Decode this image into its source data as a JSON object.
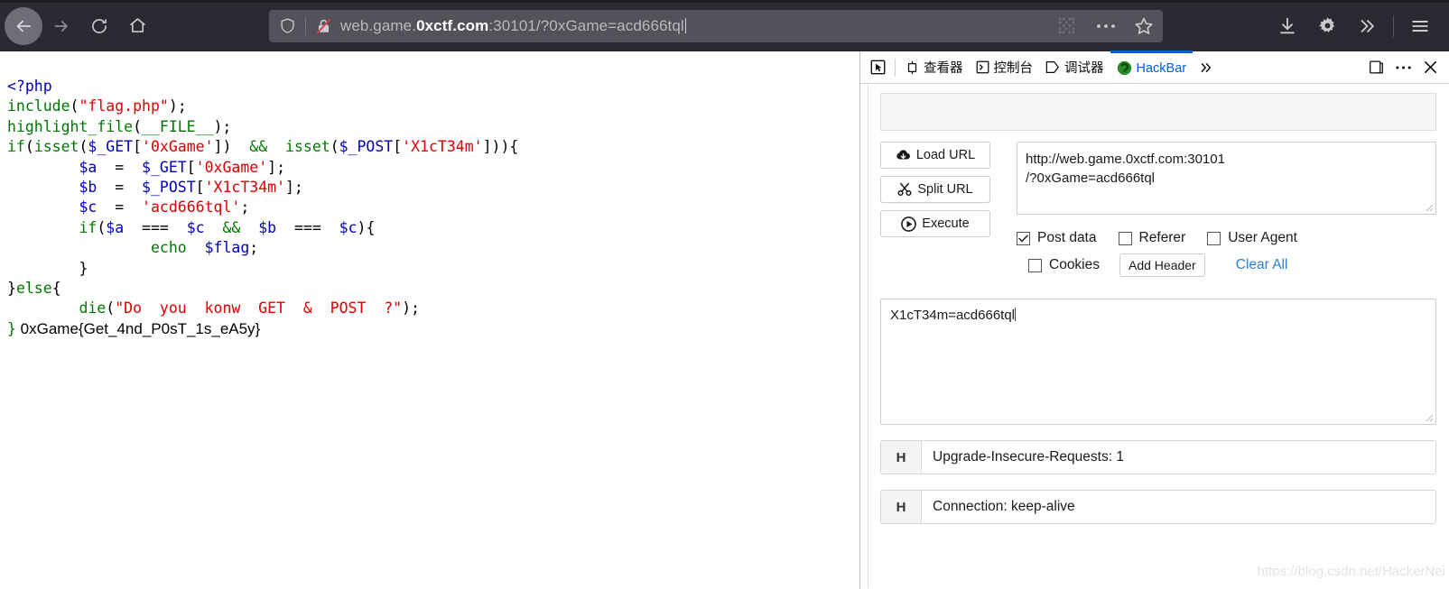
{
  "browser": {
    "nav": {
      "back_icon": "arrow-left-icon",
      "forward_icon": "arrow-right-icon",
      "reload_icon": "reload-icon",
      "home_icon": "home-icon"
    },
    "urlbar": {
      "shield_icon": "shield-icon",
      "lock_icon": "lock-crossed-out-icon",
      "url_prefix": "web.game.",
      "url_host": "0xctf.com",
      "url_suffix": ":30101/?0xGame=acd666tql",
      "full_url": "web.game.0xctf.com:30101/?0xGame=acd666tql",
      "qr_icon": "qr-code-icon",
      "dots_icon": "page-actions-icon",
      "star_icon": "bookmark-star-icon"
    },
    "toolbar_right": {
      "download_icon": "download-icon",
      "settings_icon": "gear-icon",
      "overflow_icon": "chevron-double-right-icon",
      "menu_icon": "hamburger-menu-icon"
    }
  },
  "page": {
    "php_source": [
      {
        "text": "<?php",
        "class": "tok-tag"
      },
      {
        "text": "\ninclude",
        "class": "tok-kw"
      },
      {
        "text": "(",
        "class": "tok-def"
      },
      {
        "text": "\"flag.php\"",
        "class": "tok-str"
      },
      {
        "text": ");",
        "class": "tok-def"
      }
    ],
    "flag_prefix": "}",
    "flag_text": "0xGame{Get_4nd_P0sT_1s_eA5y}",
    "code_lines": [
      "<?php",
      "include(\"flag.php\");",
      "highlight_file(__FILE__);",
      "if(isset($_GET['0xGame'])  && isset($_POST['X1cT34m'])){",
      "        $a  =  $_GET['0xGame'];",
      "        $b  =  $_POST['X1cT34m'];",
      "        $c  =  'acd666tql';",
      "        if($a  ===  $c  &&  $b  ===  $c){",
      "                echo  $flag;",
      "        }",
      "}else{",
      "        die(\"Do  you  konw  GET  &  POST  ?\");"
    ]
  },
  "devtools": {
    "picker_icon": "element-picker-icon",
    "tabs": [
      {
        "label": "查看器",
        "icon": "inspector-icon",
        "active": false
      },
      {
        "label": "控制台",
        "icon": "console-icon",
        "active": false
      },
      {
        "label": "调试器",
        "icon": "debugger-icon",
        "active": false
      },
      {
        "label": "HackBar",
        "icon": "hackbar-icon",
        "active": true
      }
    ],
    "overflow_label": "»",
    "right_buttons": {
      "dock_icon": "dock-position-icon",
      "meatball_icon": "devtools-settings-icon",
      "close_icon": "close-icon"
    }
  },
  "hackbar": {
    "buttons": [
      {
        "label": "Load URL",
        "icon": "cloud-download-icon"
      },
      {
        "label": "Split URL",
        "icon": "scissors-icon"
      },
      {
        "label": "Execute",
        "icon": "play-circle-icon"
      }
    ],
    "url_field": {
      "value": "http://web.game.0xctf.com:30101/?0xGame=acd666tql",
      "line1": "http://web.game.0xctf.com:30101",
      "line2": "/?0xGame=acd666tql"
    },
    "options": [
      {
        "label": "Post data",
        "checked": true
      },
      {
        "label": "Referer",
        "checked": false
      },
      {
        "label": "User Agent",
        "checked": false
      },
      {
        "label": "Cookies",
        "checked": false
      }
    ],
    "add_header_label": "Add Header",
    "clear_all_label": "Clear All",
    "post_data": "X1cT34m=acd666tql",
    "headers": [
      {
        "tag": "H",
        "value": "Upgrade-Insecure-Requests: 1"
      },
      {
        "tag": "H",
        "value": "Connection: keep-alive"
      }
    ]
  },
  "watermark": "https://blog.csdn.net/HackerNei",
  "colors": {
    "chrome_bg": "#2b2a33",
    "urlbar_bg": "#52525a",
    "accent": "#0060df",
    "link": "#2f7fd1",
    "php_keyword": "#007700",
    "php_variable": "#0000bb",
    "php_string": "#dd0000",
    "hackbar_icon": "#2a8c2a"
  }
}
